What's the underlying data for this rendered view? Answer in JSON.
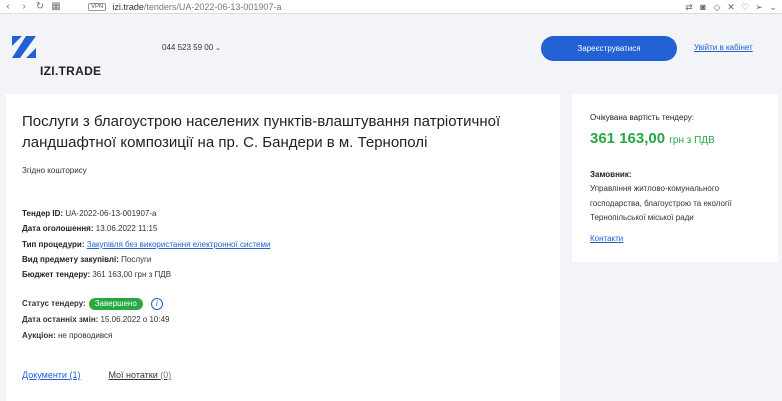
{
  "browser": {
    "vpn_label": "VPN",
    "url_host": "izi.trade",
    "url_path": "/tenders/UA-2022-06-13-001907-a"
  },
  "header": {
    "logo_text": "IZI.TRADE",
    "phone": "044 523 59 00",
    "register_button": "Зареєструватися",
    "login_link": "Увійти в кабінет"
  },
  "tender": {
    "title": "Послуги з благоустрою населених пунктів-влаштування патріотичної ландшафтної композиції на пр. С. Бандери в м. Тернополі",
    "subtitle": "Згідно кошторису",
    "fields": [
      {
        "label": "Тендер ID:",
        "value": "UA-2022-06-13-001907-a"
      },
      {
        "label": "Дата оголошення:",
        "value": "13.06.2022 11:15"
      },
      {
        "label": "Тип процедури:",
        "value": "Закупівля без використання електронної системи"
      },
      {
        "label": "Вид предмету закупівлі:",
        "value": "Послуги"
      },
      {
        "label": "Бюджет тендеру:",
        "value": "361 163,00 грн з ПДВ"
      }
    ],
    "status_label": "Статус тендеру:",
    "status_value": "Завершено",
    "changes_label": "Дата останніх змін:",
    "changes_value": "15.06.2022 о 10:49",
    "auction_label": "Аукціон:",
    "auction_value": "не проводився",
    "tab_documents": "Документи (1)",
    "tab_notes": "Мої нотатки",
    "tab_notes_count": "(0)"
  },
  "side": {
    "expected_label": "Очікувана вартість тендеру:",
    "price_amount": "361 163,00",
    "price_unit": "грн з ПДВ",
    "customer_label": "Замовник:",
    "customer_name": "Управління житлово-комунального господарства, благоустрою та екології Тернопільської міської ради",
    "contacts_link": "Контакти"
  },
  "colors": {
    "accent": "#2161d4",
    "status_green": "#27a844",
    "background": "#f2f4f7"
  }
}
